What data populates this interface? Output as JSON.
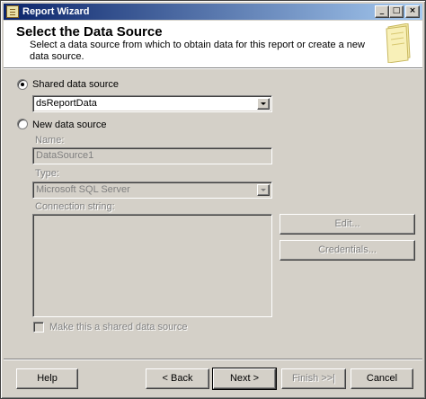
{
  "window": {
    "title": "Report Wizard",
    "controls": {
      "minimize": "_",
      "maximize": "□",
      "close": "×"
    }
  },
  "header": {
    "title": "Select the Data Source",
    "description": "Select a data source from which to obtain data for this report or create a new data source.",
    "art_icon": "wizard-pages-icon"
  },
  "shared": {
    "radio_label": "Shared data source",
    "selected": true,
    "value": "dsReportData"
  },
  "new_source": {
    "radio_label": "New data source",
    "selected": false,
    "name_label": "Name:",
    "name_value": "DataSource1",
    "type_label": "Type:",
    "type_value": "Microsoft SQL Server",
    "conn_label": "Connection string:",
    "edit_button": "Edit...",
    "credentials_button": "Credentials...",
    "shared_checkbox_label": "Make this a shared data source",
    "shared_checkbox_checked": false
  },
  "footer": {
    "help": "Help",
    "back": "< Back",
    "next": "Next >",
    "finish": "Finish >>|",
    "cancel": "Cancel"
  },
  "colors": {
    "titlebar_start": "#0a246a",
    "titlebar_end": "#a6caf0",
    "face": "#d4d0c8",
    "disabled_text": "#808080"
  }
}
